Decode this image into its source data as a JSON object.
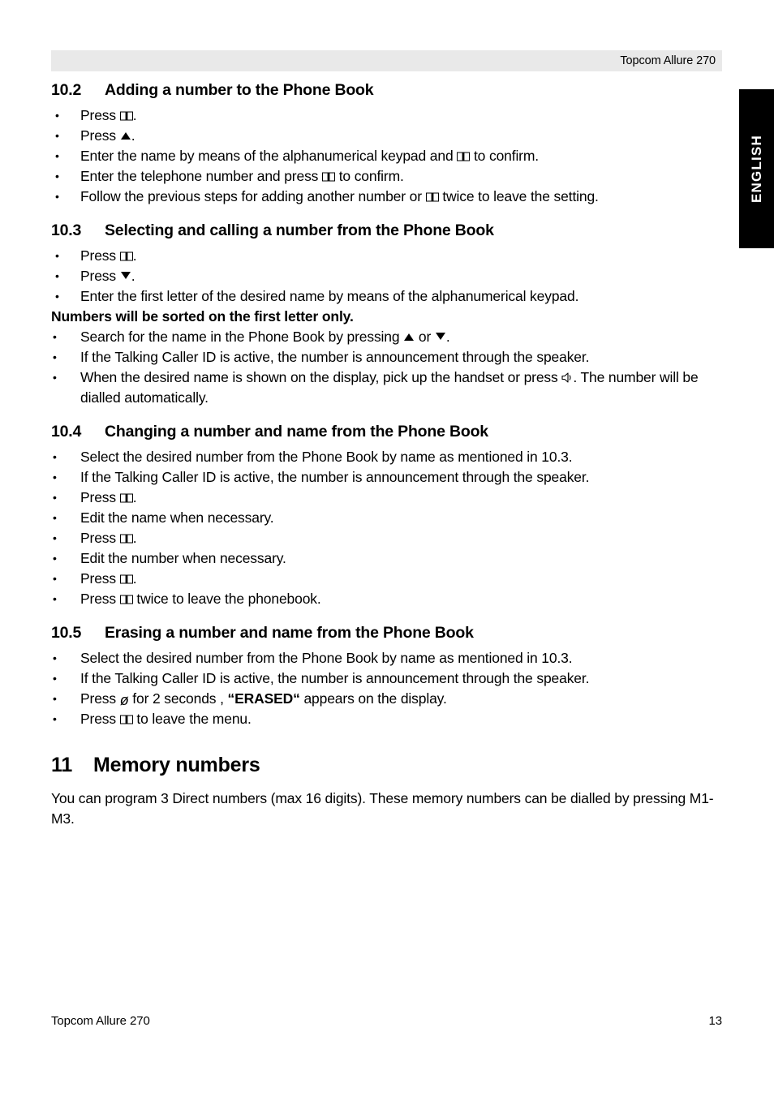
{
  "header": {
    "title": "Topcom Allure 270"
  },
  "side_tab": {
    "label": "ENGLISH"
  },
  "sections": [
    {
      "number": "10.2",
      "title": "Adding a number to the Phone Book",
      "items": [
        {
          "pre": "Press ",
          "icon": "book-icon",
          "post": "."
        },
        {
          "pre": "Press ",
          "icon": "arrow-up-icon",
          "post": "."
        },
        {
          "pre": "Enter the name by means of the alphanumerical keypad and ",
          "icon": "book-icon",
          "post": " to confirm."
        },
        {
          "pre": "Enter the telephone number and press ",
          "icon": "book-icon",
          "post": " to confirm."
        },
        {
          "pre": "Follow the previous steps for adding another number or ",
          "icon": "book-icon",
          "post": " twice to leave the setting."
        }
      ]
    },
    {
      "number": "10.3",
      "title": "Selecting and calling a number from the Phone Book",
      "items": [
        {
          "pre": "Press ",
          "icon": "book-icon",
          "post": "."
        },
        {
          "pre": "Press ",
          "icon": "arrow-down-icon",
          "post": "."
        },
        {
          "pre": "Enter the first letter of the desired name by means of the alphanumerical keypad.",
          "icon": "",
          "post": ""
        }
      ],
      "note": "Numbers will be sorted on the first letter only.",
      "items2": [
        {
          "pre": "Search for the name in the Phone Book by pressing ",
          "icon": "arrow-up-icon",
          "mid": " or ",
          "icon2": "arrow-down-icon",
          "post": "."
        },
        {
          "pre": "If the Talking Caller ID is active, the number is announcement through the speaker.",
          "icon": "",
          "post": ""
        },
        {
          "pre": "When the desired name is shown on the display, pick up the handset or press ",
          "icon": "speaker-icon",
          "post": ". The number will be dialled automatically."
        }
      ]
    },
    {
      "number": "10.4",
      "title": "Changing a number and name from the Phone Book",
      "items": [
        {
          "pre": "Select the desired number from the Phone Book by name as mentioned in 10.3.",
          "icon": "",
          "post": ""
        },
        {
          "pre": "If the Talking Caller ID is active, the number is announcement through the speaker.",
          "icon": "",
          "post": ""
        },
        {
          "pre": "Press ",
          "icon": "book-icon",
          "post": "."
        },
        {
          "pre": "Edit the name when necessary.",
          "icon": "",
          "post": ""
        },
        {
          "pre": "Press ",
          "icon": "book-icon",
          "post": "."
        },
        {
          "pre": "Edit the number when necessary.",
          "icon": "",
          "post": ""
        },
        {
          "pre": "Press ",
          "icon": "book-icon",
          "post": "."
        },
        {
          "pre": "Press ",
          "icon": "book-icon",
          "post": " twice to leave the phonebook."
        }
      ]
    },
    {
      "number": "10.5",
      "title": "Erasing a number and name from the Phone Book",
      "items": [
        {
          "pre": "Select the desired number from the Phone Book by name as mentioned in 10.3.",
          "icon": "",
          "post": ""
        },
        {
          "pre": "If the Talking Caller ID is active, the number is announcement through the speaker.",
          "icon": "",
          "post": ""
        },
        {
          "pre": "Press ",
          "icon": "delete-slash-icon",
          "mid": " for 2 seconds , ",
          "bold": "“ERASED“",
          "post": " appears on the display."
        },
        {
          "pre": "Press ",
          "icon": "book-icon",
          "post": " to leave the menu."
        }
      ]
    }
  ],
  "chapter": {
    "number": "11",
    "title": "Memory numbers",
    "body": "You can program 3 Direct numbers (max 16 digits). These memory numbers can be dialled by pressing M1-M3."
  },
  "footer": {
    "left": "Topcom Allure 270",
    "page": "13"
  }
}
